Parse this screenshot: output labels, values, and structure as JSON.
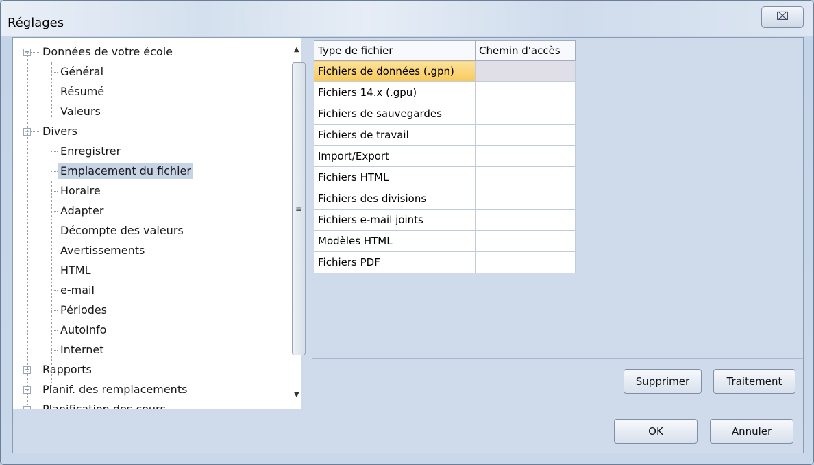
{
  "window": {
    "title": "Réglages",
    "close_glyph": "⌧"
  },
  "tree": {
    "items": [
      {
        "label": "Données de votre école",
        "level": 0,
        "expander": "−"
      },
      {
        "label": "Général",
        "level": 1
      },
      {
        "label": "Résumé",
        "level": 1
      },
      {
        "label": "Valeurs",
        "level": 1
      },
      {
        "label": "Divers",
        "level": 0,
        "expander": "−"
      },
      {
        "label": "Enregistrer",
        "level": 1
      },
      {
        "label": "Emplacement du fichier",
        "level": 1,
        "selected": true
      },
      {
        "label": "Horaire",
        "level": 1
      },
      {
        "label": "Adapter",
        "level": 1
      },
      {
        "label": "Décompte des valeurs",
        "level": 1
      },
      {
        "label": "Avertissements",
        "level": 1
      },
      {
        "label": "HTML",
        "level": 1
      },
      {
        "label": "e-mail",
        "level": 1
      },
      {
        "label": "Périodes",
        "level": 1
      },
      {
        "label": "AutoInfo",
        "level": 1
      },
      {
        "label": "Internet",
        "level": 1
      },
      {
        "label": "Rapports",
        "level": 0,
        "expander": "+"
      },
      {
        "label": "Planif. des remplacements",
        "level": 0,
        "expander": "+"
      },
      {
        "label": "Planification des cours",
        "level": 0,
        "expander": "+"
      }
    ]
  },
  "grid": {
    "headers": [
      "Type de fichier",
      "Chemin d'accès"
    ],
    "rows": [
      {
        "type": "Fichiers de données (.gpn)",
        "path": ""
      },
      {
        "type": "Fichiers 14.x (.gpu)",
        "path": ""
      },
      {
        "type": "Fichiers de sauvegardes",
        "path": ""
      },
      {
        "type": "Fichiers de travail",
        "path": ""
      },
      {
        "type": "Import/Export",
        "path": ""
      },
      {
        "type": "Fichiers HTML",
        "path": ""
      },
      {
        "type": "Fichiers des divisions",
        "path": ""
      },
      {
        "type": "Fichiers e-mail joints",
        "path": ""
      },
      {
        "type": "Modèles HTML",
        "path": ""
      },
      {
        "type": "Fichiers PDF",
        "path": ""
      }
    ]
  },
  "buttons": {
    "delete": "Supprimer",
    "edit": "Traitement",
    "ok": "OK",
    "cancel": "Annuler"
  }
}
